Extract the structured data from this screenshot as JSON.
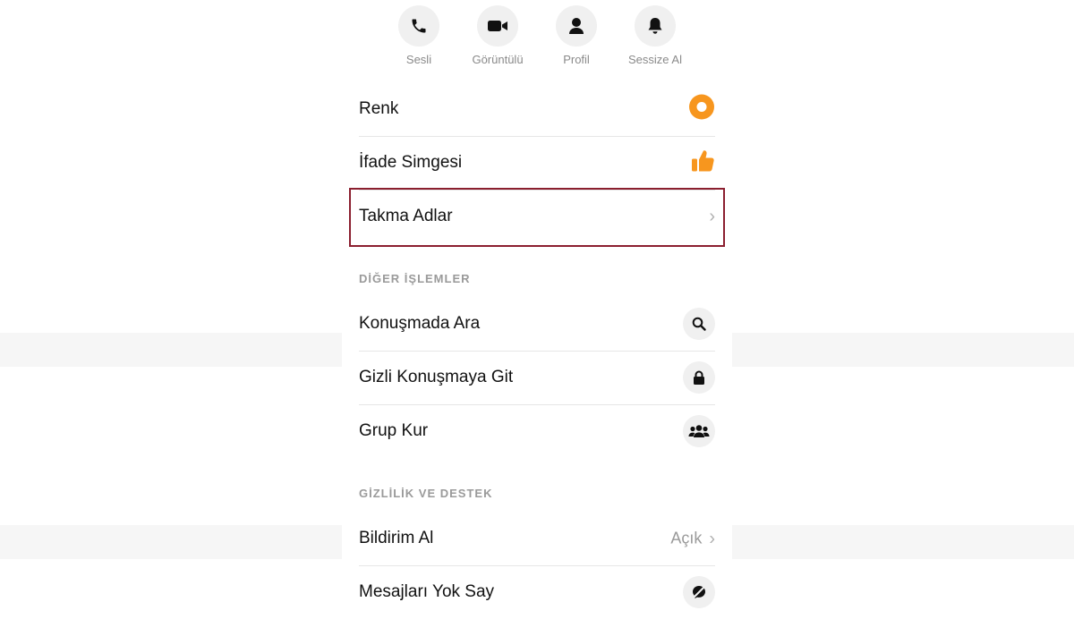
{
  "actions": [
    {
      "label": "Sesli",
      "icon": "phone-icon"
    },
    {
      "label": "Görüntülü",
      "icon": "video-camera-icon"
    },
    {
      "label": "Profil",
      "icon": "profile-icon"
    },
    {
      "label": "Sessize Al",
      "icon": "bell-icon"
    }
  ],
  "settings": {
    "color": {
      "label": "Renk",
      "icon": "color-dot-icon",
      "accent": "#F7961E"
    },
    "emoji": {
      "label": "İfade Simgesi",
      "icon": "thumbs-up-icon"
    },
    "nicknames": {
      "label": "Takma Adlar",
      "icon": "chevron-right-icon"
    }
  },
  "other_actions": {
    "header": "DİĞER İŞLEMLER",
    "items": [
      {
        "label": "Konuşmada Ara",
        "icon": "search-icon"
      },
      {
        "label": "Gizli Konuşmaya Git",
        "icon": "lock-icon"
      },
      {
        "label": "Grup Kur",
        "icon": "group-icon"
      }
    ]
  },
  "privacy": {
    "header": "GİZLİLİK VE DESTEK",
    "items": [
      {
        "label": "Bildirim Al",
        "value": "Açık",
        "icon": "chevron-right-icon"
      },
      {
        "label": "Mesajları Yok Say",
        "icon": "ignore-icon"
      }
    ]
  },
  "colors": {
    "highlight_border": "#8B1F2F",
    "accent_orange": "#F7961E"
  }
}
